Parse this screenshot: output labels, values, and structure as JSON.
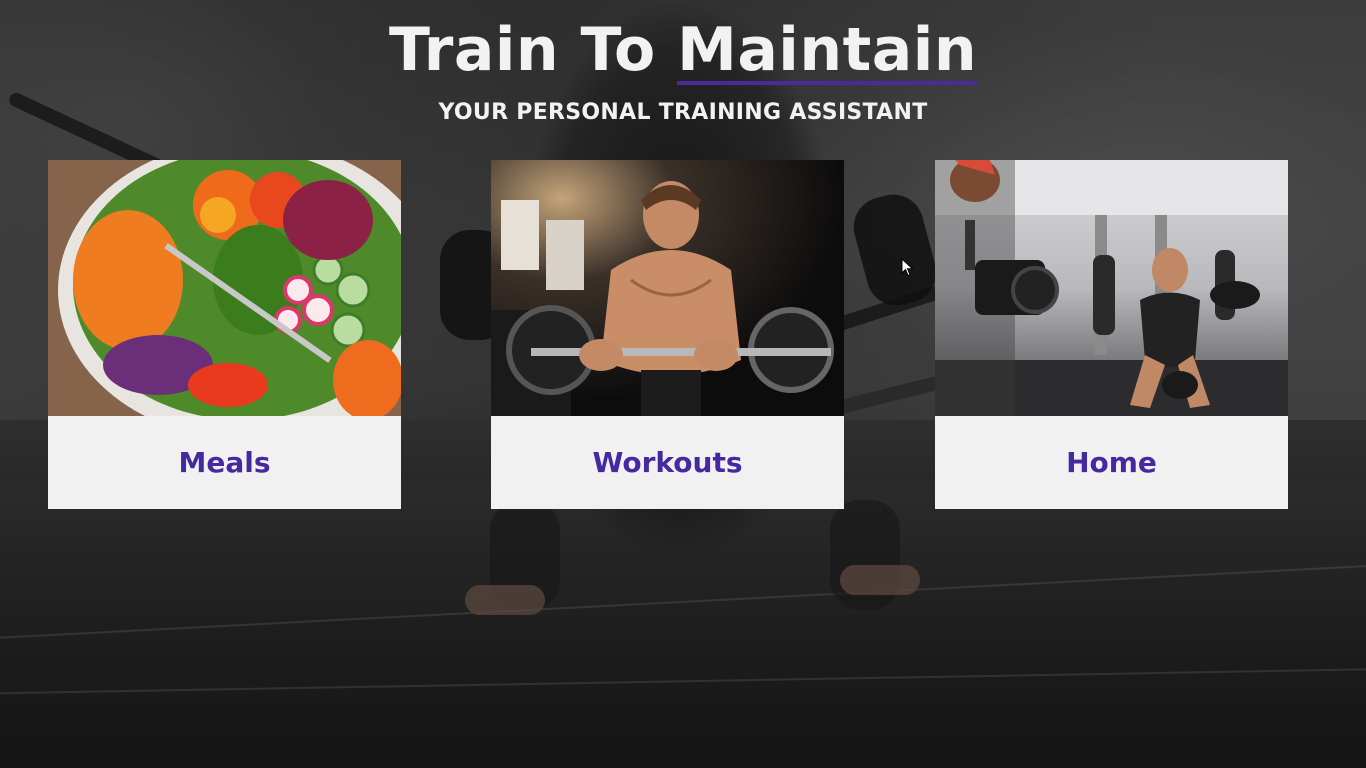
{
  "header": {
    "title_part1": "Train To",
    "title_part2": "Maintain",
    "subtitle": "YOUR PERSONAL TRAINING ASSISTANT"
  },
  "cards": [
    {
      "label": "Meals",
      "icon": "salad-bowl-image"
    },
    {
      "label": "Workouts",
      "icon": "man-lifting-barbell-image"
    },
    {
      "label": "Home",
      "icon": "woman-boxing-gym-image"
    }
  ],
  "colors": {
    "accent": "#4429a0",
    "underline": "#4b2a9a",
    "card_bg": "#f1f1f1",
    "title_text": "#f2f2f2"
  }
}
